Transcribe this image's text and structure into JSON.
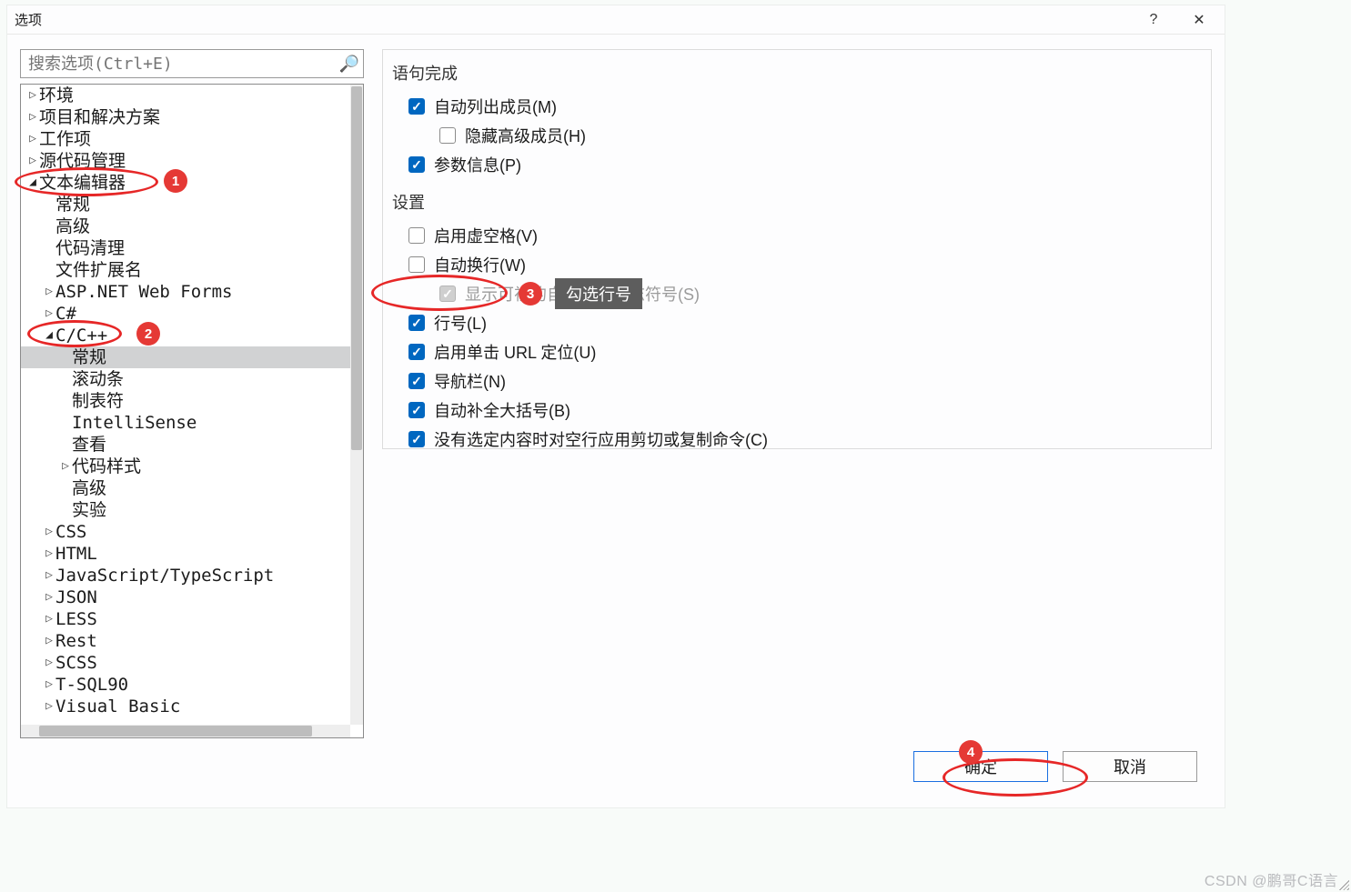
{
  "title": "选项",
  "search": {
    "placeholder": "搜索选项(Ctrl+E)"
  },
  "tree": [
    {
      "indent": 0,
      "caret": "closed",
      "label": "环境"
    },
    {
      "indent": 0,
      "caret": "closed",
      "label": "项目和解决方案"
    },
    {
      "indent": 0,
      "caret": "closed",
      "label": "工作项"
    },
    {
      "indent": 0,
      "caret": "closed",
      "label": "源代码管理"
    },
    {
      "indent": 0,
      "caret": "open",
      "label": "文本编辑器"
    },
    {
      "indent": 1,
      "caret": "none",
      "label": "常规"
    },
    {
      "indent": 1,
      "caret": "none",
      "label": "高级"
    },
    {
      "indent": 1,
      "caret": "none",
      "label": "代码清理"
    },
    {
      "indent": 1,
      "caret": "none",
      "label": "文件扩展名"
    },
    {
      "indent": 1,
      "caret": "closed",
      "label": "ASP.NET Web Forms"
    },
    {
      "indent": 1,
      "caret": "closed",
      "label": "C#"
    },
    {
      "indent": 1,
      "caret": "open",
      "label": "C/C++"
    },
    {
      "indent": 2,
      "caret": "none",
      "label": "常规",
      "selected": true
    },
    {
      "indent": 2,
      "caret": "none",
      "label": "滚动条"
    },
    {
      "indent": 2,
      "caret": "none",
      "label": "制表符"
    },
    {
      "indent": 2,
      "caret": "none",
      "label": "IntelliSense"
    },
    {
      "indent": 2,
      "caret": "none",
      "label": "查看"
    },
    {
      "indent": 2,
      "caret": "closed",
      "label": "代码样式"
    },
    {
      "indent": 2,
      "caret": "none",
      "label": "高级"
    },
    {
      "indent": 2,
      "caret": "none",
      "label": "实验"
    },
    {
      "indent": 1,
      "caret": "closed",
      "label": "CSS"
    },
    {
      "indent": 1,
      "caret": "closed",
      "label": "HTML"
    },
    {
      "indent": 1,
      "caret": "closed",
      "label": "JavaScript/TypeScript"
    },
    {
      "indent": 1,
      "caret": "closed",
      "label": "JSON"
    },
    {
      "indent": 1,
      "caret": "closed",
      "label": "LESS"
    },
    {
      "indent": 1,
      "caret": "closed",
      "label": "Rest"
    },
    {
      "indent": 1,
      "caret": "closed",
      "label": "SCSS"
    },
    {
      "indent": 1,
      "caret": "closed",
      "label": "T-SQL90"
    },
    {
      "indent": 1,
      "caret": "closed",
      "label": "Visual Basic"
    }
  ],
  "sections": {
    "section1_title": "语句完成",
    "opt_auto_list": "自动列出成员(M)",
    "opt_hide_adv": "隐藏高级成员(H)",
    "opt_param": "参数信息(P)",
    "section2_title": "设置",
    "opt_virt": "启用虚空格(V)",
    "opt_wrap": "自动换行(W)",
    "opt_glyph": "显示可视的自动换行标志符号(S)",
    "opt_linenum": "行号(L)",
    "opt_url": "启用单击 URL 定位(U)",
    "opt_nav": "导航栏(N)",
    "opt_brace": "自动补全大括号(B)",
    "opt_cut": "没有选定内容时对空行应用剪切或复制命令(C)"
  },
  "tooltip": "勾选行号",
  "buttons": {
    "ok": "确定",
    "cancel": "取消"
  },
  "badges": {
    "b1": "1",
    "b2": "2",
    "b3": "3",
    "b4": "4"
  },
  "watermark": "CSDN @鹏哥C语言"
}
